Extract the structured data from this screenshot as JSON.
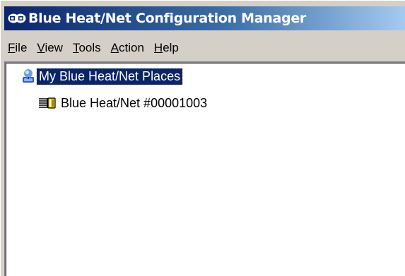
{
  "window": {
    "title": "Blue Heat/Net Configuration Manager",
    "title_icon": "network-devices-icon",
    "active_title_color": "#0a246a"
  },
  "menu": {
    "items": [
      {
        "label_u": "F",
        "label_rest": "ile"
      },
      {
        "label_u": "V",
        "label_rest": "iew"
      },
      {
        "label_u": "T",
        "label_rest": "ools"
      },
      {
        "label_u": "A",
        "label_rest": "ction"
      },
      {
        "label_u": "H",
        "label_rest": "elp"
      }
    ]
  },
  "tree": {
    "root": {
      "label": "My Blue Heat/Net Places",
      "icon": "network-places-icon",
      "selected": true
    },
    "children": [
      {
        "label": "Blue Heat/Net #00001003",
        "icon": "device-icon"
      }
    ]
  }
}
